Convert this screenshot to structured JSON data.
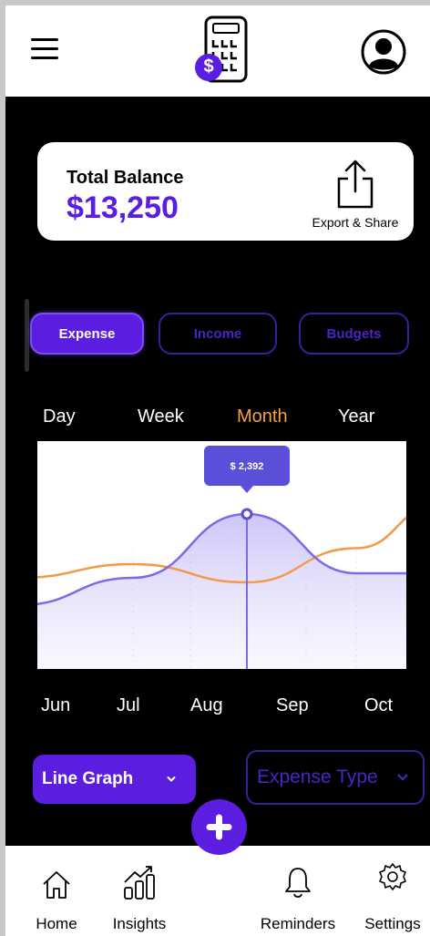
{
  "header": {
    "logo_badge": "$",
    "logo_icon": "calculator-icon",
    "menu_icon": "hamburger-menu-icon",
    "profile_icon": "user-avatar-icon"
  },
  "balance": {
    "label": "Total Balance",
    "value": "$13,250",
    "export_label": "Export & Share",
    "export_icon": "share-icon"
  },
  "tabs": [
    {
      "label": "Expense",
      "active": true
    },
    {
      "label": "Income",
      "active": false
    },
    {
      "label": "Budgets",
      "active": false
    }
  ],
  "periods": [
    {
      "label": "Day",
      "active": false
    },
    {
      "label": "Week",
      "active": false
    },
    {
      "label": "Month",
      "active": true
    },
    {
      "label": "Year",
      "active": false
    }
  ],
  "chart_data": {
    "type": "line",
    "categories": [
      "Jun",
      "Jul",
      "Aug",
      "Sep",
      "Oct"
    ],
    "series": [
      {
        "color": "#7c6ae6",
        "values": [
          0.28,
          0.4,
          0.68,
          0.42,
          0.42
        ]
      },
      {
        "color": "#f29a4a",
        "values": [
          0.4,
          0.46,
          0.38,
          0.53,
          0.72
        ]
      }
    ],
    "highlight": {
      "category": "Aug",
      "label": "$ 2,392"
    },
    "grid": false,
    "legend": "none"
  },
  "months": [
    "Jun",
    "Jul",
    "Aug",
    "Sep",
    "Oct"
  ],
  "controls": {
    "graph_type": "Line Graph",
    "expense_type": "Expense Type"
  },
  "nav": {
    "home": "Home",
    "insights": "Insights",
    "reminders": "Reminders",
    "settings": "Settings",
    "add_icon": "plus-icon"
  },
  "colors": {
    "accent": "#5b1ee0",
    "active_period": "#f7a23a",
    "background": "#000000"
  }
}
